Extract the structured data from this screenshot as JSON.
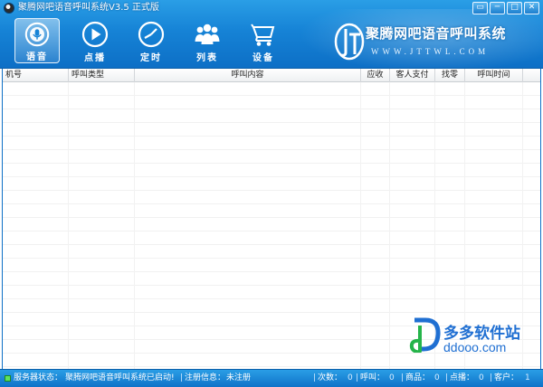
{
  "window": {
    "title": "聚腾网吧语音呼叫系统V3.5 正式版",
    "minimize_glyph": "▭",
    "restore_glyph": "─",
    "maximize_glyph": "□",
    "close_glyph": "✕"
  },
  "toolbar": {
    "items": [
      {
        "label": "语音",
        "icon": "voice-icon",
        "active": true
      },
      {
        "label": "点播",
        "icon": "play-icon",
        "active": false
      },
      {
        "label": "定时",
        "icon": "clock-icon",
        "active": false
      },
      {
        "label": "列表",
        "icon": "users-icon",
        "active": false
      },
      {
        "label": "设备",
        "icon": "cart-icon",
        "active": false
      }
    ]
  },
  "logo": {
    "name": "聚腾网吧语音呼叫系统",
    "url": "WWW.JTTWL.COM"
  },
  "table": {
    "columns": [
      "机号",
      "呼叫类型",
      "呼叫内容",
      "应收",
      "客人支付",
      "找零",
      "呼叫时间"
    ],
    "rows": []
  },
  "status": {
    "server_label": "服务器状态：",
    "server_value": "聚腾网吧语音呼叫系统已启动!",
    "reg_label": "注册信息：",
    "reg_value": "未注册",
    "counts": [
      {
        "label": "次数：",
        "value": "0"
      },
      {
        "label": "呼叫：",
        "value": "0"
      },
      {
        "label": "商品：",
        "value": "0"
      },
      {
        "label": "点播：",
        "value": "0"
      },
      {
        "label": "客户：",
        "value": "1"
      }
    ]
  },
  "watermark": {
    "name": "多多软件站",
    "url": "ddooo.com"
  },
  "colors": {
    "frame_blue": "#1683d6",
    "status_led": "#5ee35e",
    "watermark_blue": "#1f6fd2"
  }
}
